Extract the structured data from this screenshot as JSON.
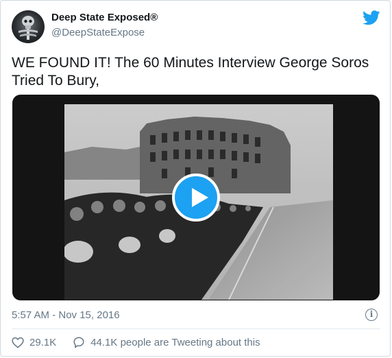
{
  "author": {
    "display_name": "Deep State Exposed®",
    "handle": "@DeepStateExpose",
    "avatar_icon": "skull-xray-avatar"
  },
  "brand": {
    "icon": "twitter-bird-icon",
    "color": "#1da1f2"
  },
  "tweet": {
    "text": "WE FOUND IT! The 60 Minutes Interview George Soros Tried To Bury,"
  },
  "media": {
    "type": "video",
    "play_icon": "play-icon",
    "accent": "#1da1f2"
  },
  "meta": {
    "timestamp": "5:57 AM - Nov 15, 2016",
    "info_icon": "info-icon"
  },
  "actions": {
    "likes": "29.1K",
    "tweeting": "44.1K people are Tweeting about this"
  },
  "colors": {
    "text": "#14171a",
    "muted": "#657786",
    "border": "#cfd9de"
  }
}
